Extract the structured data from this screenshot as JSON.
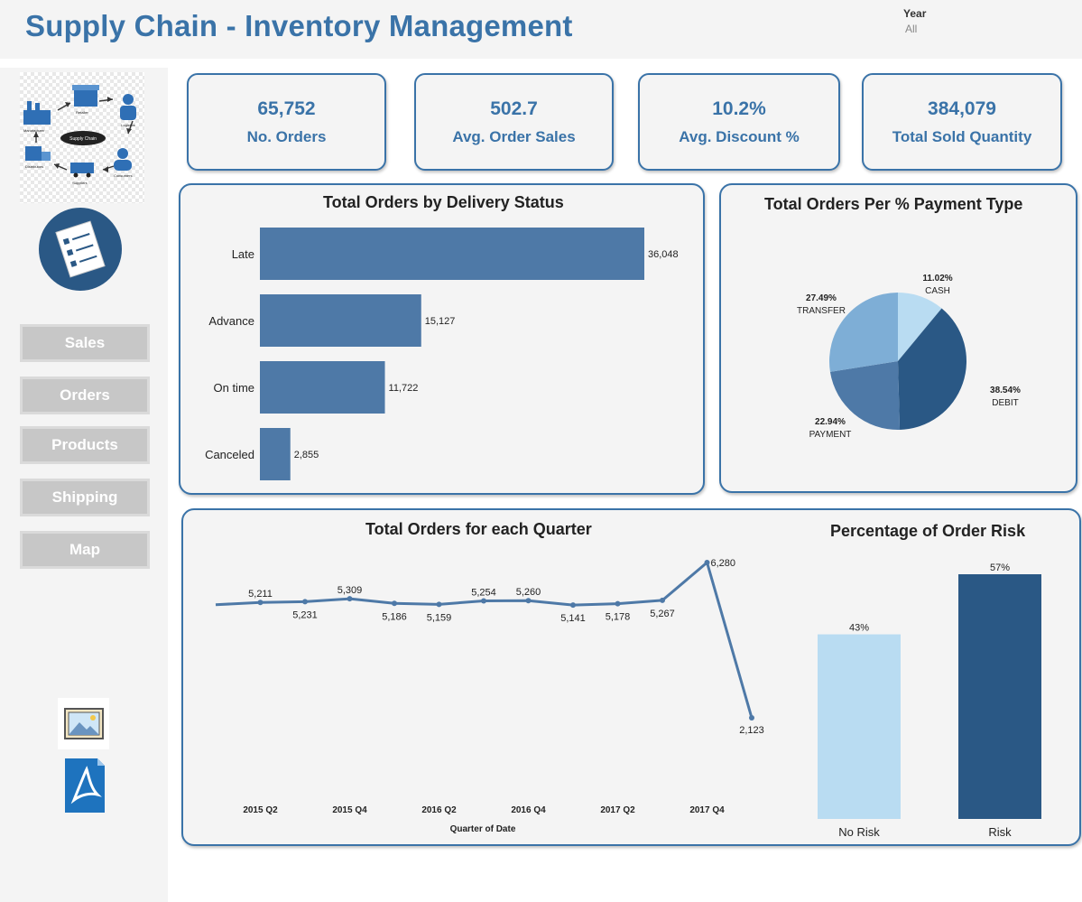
{
  "header": {
    "title": "Supply Chain - Inventory Management",
    "year_filter": {
      "label": "Year",
      "value": "All"
    }
  },
  "sidebar": {
    "diagram_labels": {
      "center": "Supply Chain",
      "nodes": [
        "Manufacturer",
        "Retailer",
        "Logistics",
        "Distributors",
        "Suppliers",
        "Consumers"
      ]
    },
    "nav": [
      {
        "label": "Sales"
      },
      {
        "label": "Orders"
      },
      {
        "label": "Products"
      },
      {
        "label": "Shipping"
      },
      {
        "label": "Map"
      }
    ],
    "icons": [
      "supply-chain-diagram-icon",
      "checklist-icon",
      "image-export-icon",
      "pdf-export-icon"
    ]
  },
  "kpis": [
    {
      "value": "65,752",
      "label": "No. Orders"
    },
    {
      "value": "502.7",
      "label": "Avg. Order Sales"
    },
    {
      "value": "10.2%",
      "label": "Avg. Discount %"
    },
    {
      "value": "384,079",
      "label": "Total Sold Quantity"
    }
  ],
  "colors": {
    "accent": "#3a73a8",
    "bar": "#4e79a7",
    "risk_dark": "#2a5885",
    "risk_light": "#b9dcf2"
  },
  "chart_data": [
    {
      "id": "delivery",
      "type": "bar",
      "orientation": "horizontal",
      "title": "Total Orders by Delivery Status",
      "categories": [
        "Late",
        "Advance",
        "On time",
        "Canceled"
      ],
      "values": [
        36048,
        15127,
        11722,
        2855
      ],
      "labels": [
        "36,048",
        "15,127",
        "11,722",
        "2,855"
      ],
      "xlim": [
        0,
        36048
      ]
    },
    {
      "id": "payment",
      "type": "pie",
      "title": "Total Orders Per % Payment Type",
      "slices": [
        {
          "name": "CASH",
          "pct_label": "11.02%",
          "value": 11.02,
          "color": "#b9dcf2"
        },
        {
          "name": "DEBIT",
          "pct_label": "38.54%",
          "value": 38.54,
          "color": "#2a5885"
        },
        {
          "name": "PAYMENT",
          "pct_label": "22.94%",
          "value": 22.94,
          "color": "#4e79a7"
        },
        {
          "name": "TRANSFER",
          "pct_label": "27.49%",
          "value": 27.49,
          "color": "#7eaed6"
        }
      ]
    },
    {
      "id": "quarterly",
      "type": "line",
      "title": "Total Orders for each Quarter",
      "xlabel": "Quarter of Date",
      "ylabel": "",
      "x": [
        "2015 Q1",
        "2015 Q2",
        "2015 Q3",
        "2015 Q4",
        "2016 Q1",
        "2016 Q2",
        "2016 Q3",
        "2016 Q4",
        "2017 Q1",
        "2017 Q2",
        "2017 Q3",
        "2017 Q4",
        "2018 Q1"
      ],
      "tick_labels": [
        "2015 Q2",
        "2015 Q4",
        "2016 Q2",
        "2016 Q4",
        "2017 Q2",
        "2017 Q4"
      ],
      "y": [
        5150,
        5211,
        5231,
        5309,
        5186,
        5159,
        5254,
        5260,
        5141,
        5178,
        5267,
        6280,
        2123
      ],
      "point_labels": [
        null,
        "5,211",
        "5,231",
        "5,309",
        "5,186",
        "5,159",
        "5,254",
        "5,260",
        "5,141",
        "5,178",
        "5,267",
        "6,280",
        "2,123"
      ],
      "grid": false
    },
    {
      "id": "risk",
      "type": "bar",
      "title": "Percentage of Order Risk",
      "categories": [
        "No Risk",
        "Risk"
      ],
      "values": [
        43,
        57
      ],
      "labels": [
        "43%",
        "57%"
      ],
      "ylim": [
        0,
        57
      ]
    }
  ]
}
